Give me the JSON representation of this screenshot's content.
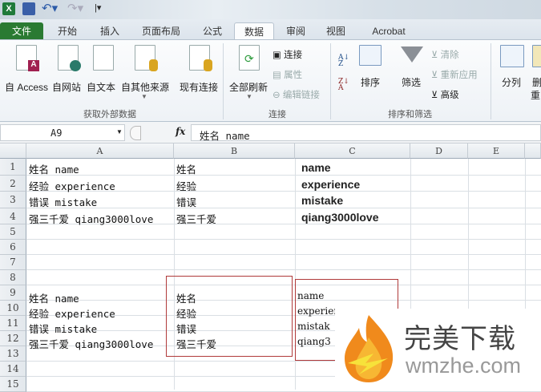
{
  "quick_access": {
    "icons": [
      "excel-icon",
      "save-icon",
      "undo-icon",
      "redo-icon",
      "customize-icon"
    ]
  },
  "tabs": [
    "文件",
    "开始",
    "插入",
    "页面布局",
    "公式",
    "数据",
    "审阅",
    "视图",
    "Acrobat"
  ],
  "active_tab": "数据",
  "ribbon": {
    "get_external": {
      "items": [
        "自 Access",
        "自网站",
        "自文本",
        "自其他来源",
        "现有连接"
      ],
      "label": "获取外部数据"
    },
    "connections": {
      "refresh_all": "全部刷新",
      "connect": "连接",
      "properties": "属性",
      "edit_links": "编辑链接",
      "label": "连接"
    },
    "sort_filter": {
      "sort": "排序",
      "filter": "筛选",
      "clear": "清除",
      "reapply": "重新应用",
      "advanced": "高级",
      "label": "排序和筛选"
    },
    "data_tools": {
      "split": "分列",
      "remove_dup_partial": "删",
      "remove_dup_partial2": "重"
    }
  },
  "formula_bar": {
    "name_box": "A9",
    "fx": "fx",
    "value": "姓名 name"
  },
  "columns": [
    "A",
    "B",
    "C",
    "D",
    "E"
  ],
  "rows": [
    "1",
    "2",
    "3",
    "4",
    "5",
    "6",
    "7",
    "8",
    "9",
    "10",
    "11",
    "12",
    "13",
    "14",
    "15"
  ],
  "cells": {
    "r1": [
      "姓名 name",
      "姓名",
      "name"
    ],
    "r2": [
      "经验 experience",
      "经验",
      "experience"
    ],
    "r3": [
      "错误 mistake",
      "错误",
      "mistake"
    ],
    "r4": [
      "强三千爱 qiang3000love",
      "强三千爱",
      "qiang3000love"
    ],
    "r9": [
      "姓名 name",
      "姓名",
      "name"
    ],
    "r10": [
      "经验 experience",
      "经验",
      "experience"
    ],
    "r11": [
      "错误 mistake",
      "错误",
      "mistak"
    ],
    "r12": [
      "强三千爱 qiang3000love",
      "强三千爱",
      "qiang3"
    ]
  },
  "watermark": {
    "title": "完美下载",
    "url": "wmzhe.com"
  }
}
